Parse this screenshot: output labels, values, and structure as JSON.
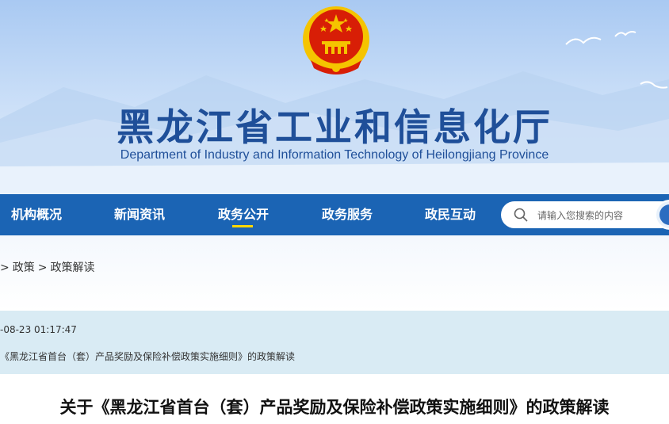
{
  "header": {
    "site_title": "黑龙江省工业和信息化厅",
    "site_subtitle": "Department of Industry and Information Technology of Heilongjiang Province",
    "emblem_icon": "national-emblem-icon",
    "colors": {
      "title": "#1f4f99",
      "nav": "#1b64b4",
      "emblem_red": "#d81e06",
      "emblem_gold": "#f5c400"
    }
  },
  "nav": {
    "items": [
      {
        "label": "机构概况"
      },
      {
        "label": "新闻资讯"
      },
      {
        "label": "政务公开",
        "active": true
      },
      {
        "label": "政务服务"
      },
      {
        "label": "政民互动"
      }
    ]
  },
  "search": {
    "placeholder": "请输入您搜索的内容",
    "icon": "search-icon"
  },
  "breadcrumb": {
    "items": [
      "政策",
      "政策解读"
    ],
    "leading_separator": ">",
    "separator": ">"
  },
  "info": {
    "date": "-08-23 01:17:47",
    "title": "《黑龙江省首台（套）产品奖励及保险补偿政策实施细则》的政策解读"
  },
  "article": {
    "title": "关于《黑龙江省首台（套）产品奖励及保险补偿政策实施细则》的政策解读"
  }
}
